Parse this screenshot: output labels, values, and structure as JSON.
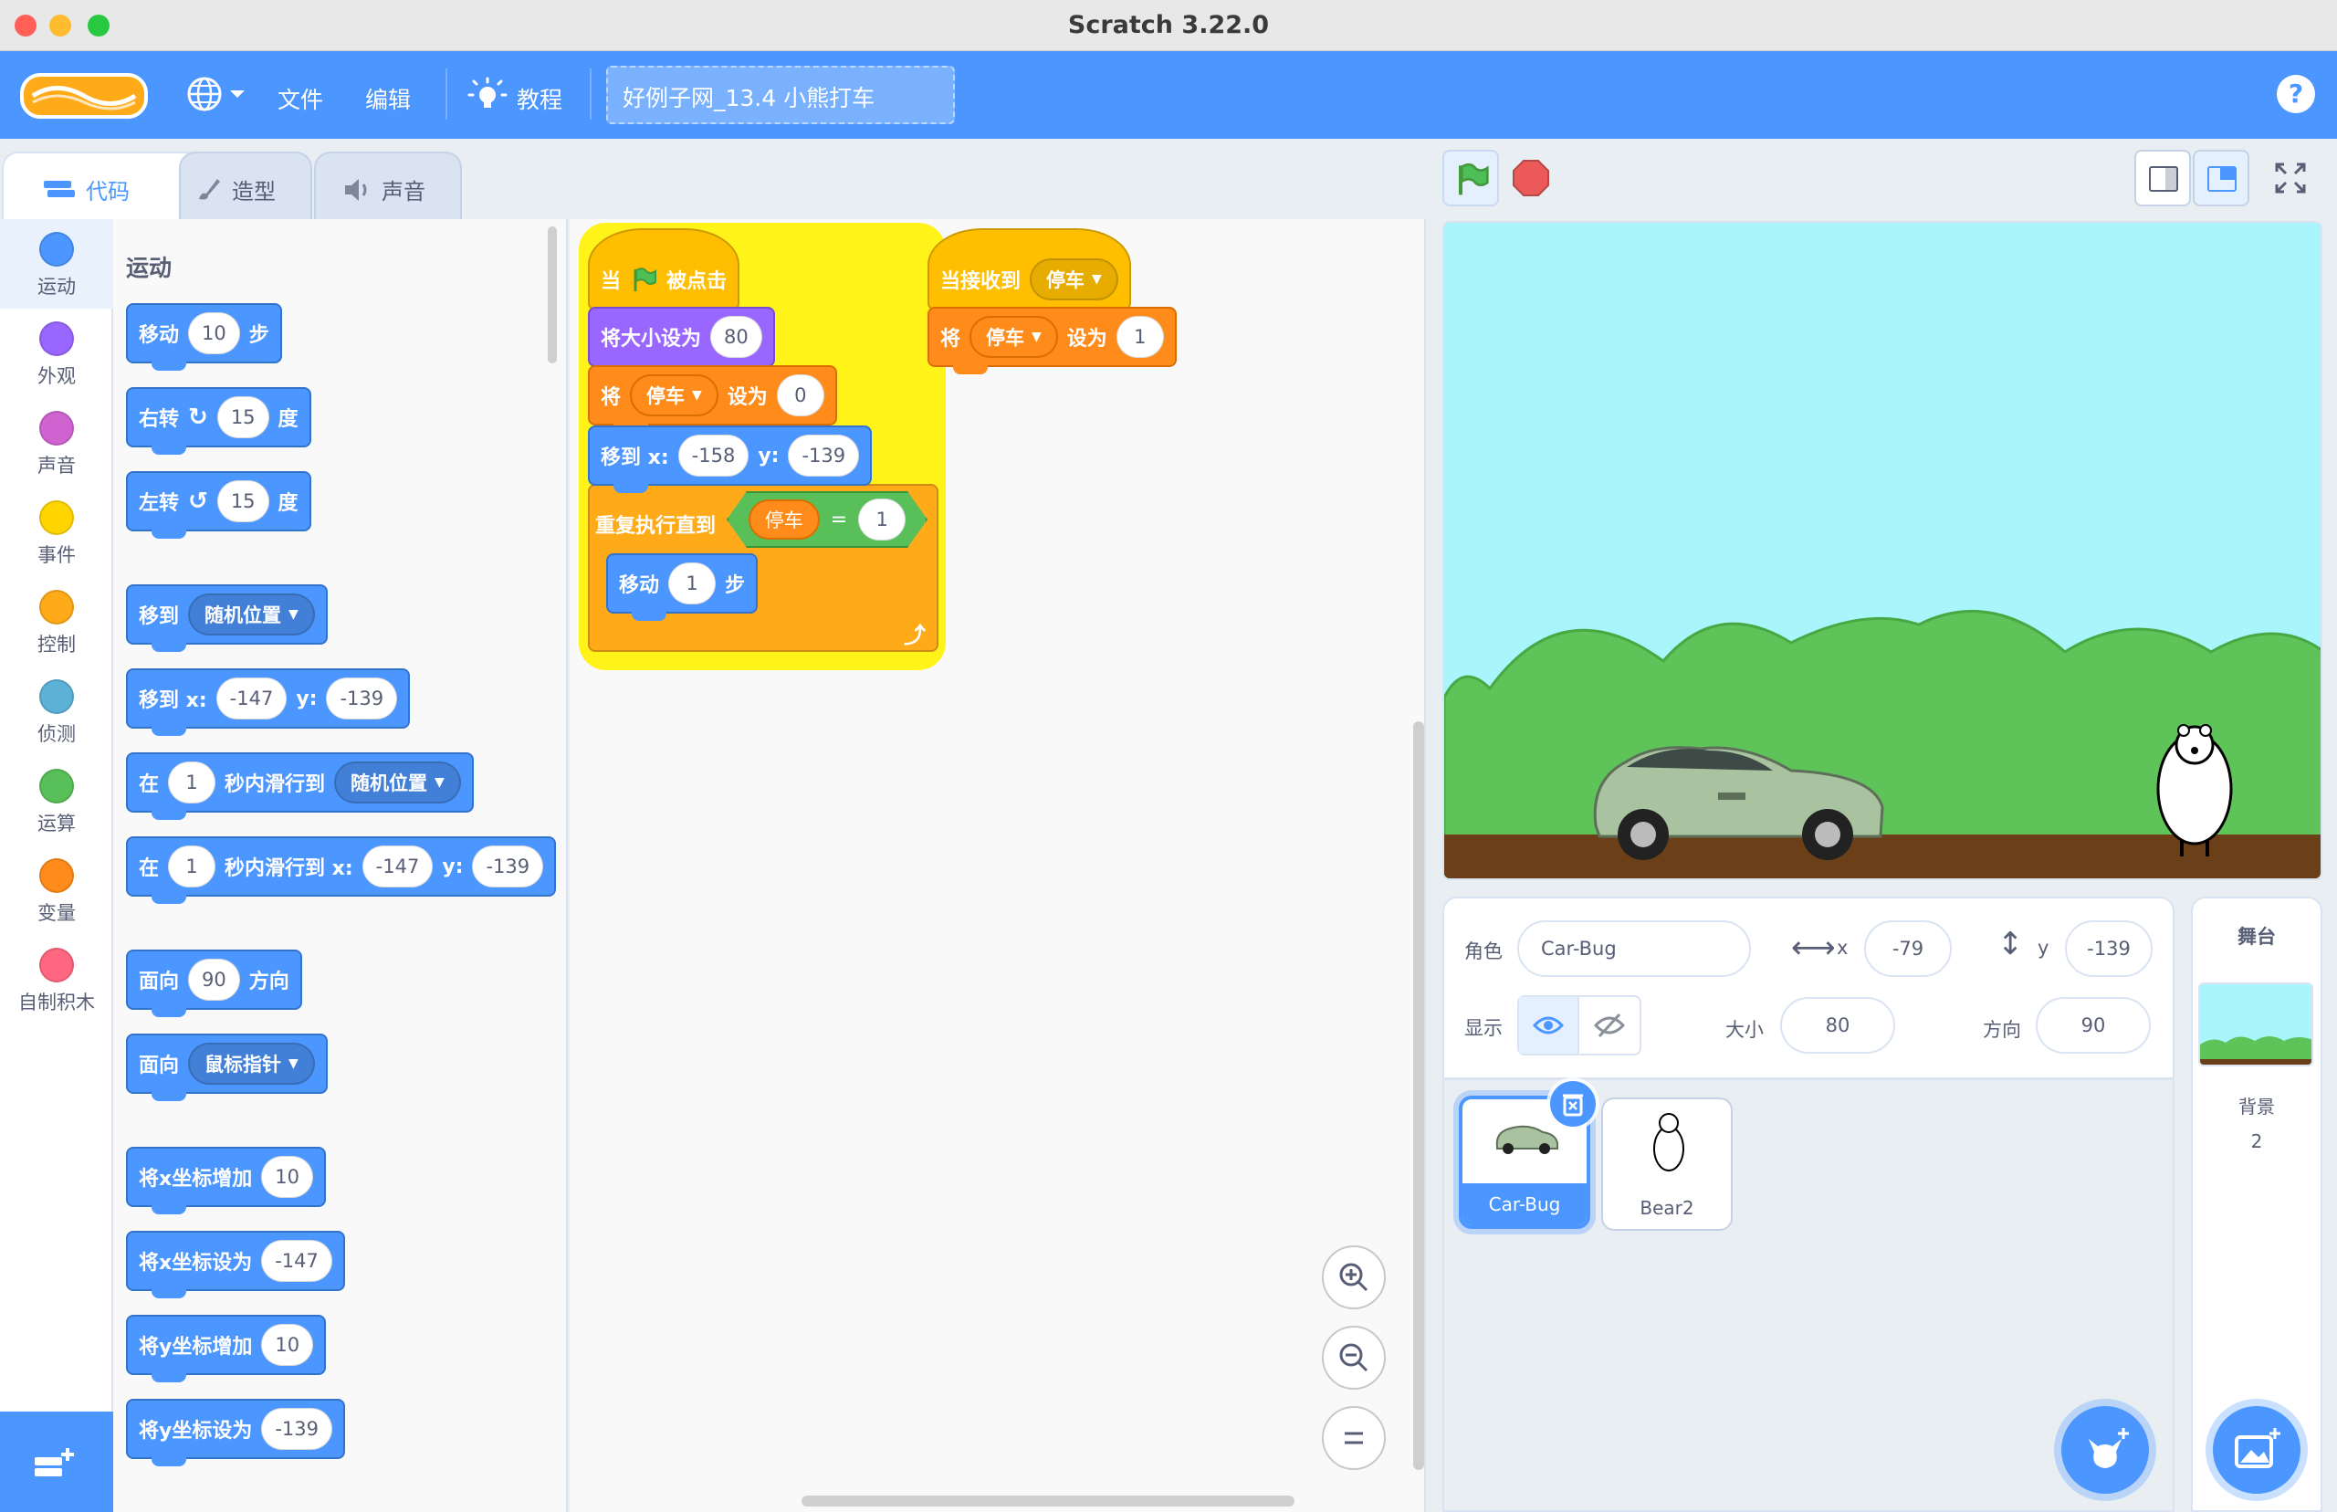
{
  "window": {
    "title": "Scratch 3.22.0"
  },
  "menu": {
    "file": "文件",
    "edit": "编辑",
    "tutorials": "教程",
    "project_title": "好例子网_13.4 小熊打车",
    "help": "?"
  },
  "tabs": {
    "code": "代码",
    "costumes": "造型",
    "sounds": "声音"
  },
  "categories": [
    {
      "label": "运动",
      "color": "#4c97ff"
    },
    {
      "label": "外观",
      "color": "#9966ff"
    },
    {
      "label": "声音",
      "color": "#cf63cf"
    },
    {
      "label": "事件",
      "color": "#ffd500"
    },
    {
      "label": "控制",
      "color": "#ffab19"
    },
    {
      "label": "侦测",
      "color": "#5cb1d6"
    },
    {
      "label": "运算",
      "color": "#59c059"
    },
    {
      "label": "变量",
      "color": "#ff8c1a"
    },
    {
      "label": "自制积木",
      "color": "#ff6680"
    }
  ],
  "palette": {
    "heading": "运动",
    "move": {
      "a": "移动",
      "n": "10",
      "b": "步"
    },
    "turn_right": {
      "a": "右转",
      "n": "15",
      "b": "度"
    },
    "turn_left": {
      "a": "左转",
      "n": "15",
      "b": "度"
    },
    "goto": {
      "a": "移到",
      "dd": "随机位置"
    },
    "goto_xy": {
      "a": "移到 x:",
      "x": "-147",
      "b": "y:",
      "y": "-139"
    },
    "glide": {
      "a": "在",
      "n": "1",
      "b": "秒内滑行到",
      "dd": "随机位置"
    },
    "glide_xy": {
      "a": "在",
      "n": "1",
      "b": "秒内滑行到 x:",
      "x": "-147",
      "c": "y:",
      "y": "-139"
    },
    "point_dir": {
      "a": "面向",
      "n": "90",
      "b": "方向"
    },
    "point_towards": {
      "a": "面向",
      "dd": "鼠标指针"
    },
    "change_x": {
      "a": "将x坐标增加",
      "n": "10"
    },
    "set_x": {
      "a": "将x坐标设为",
      "n": "-147"
    },
    "change_y": {
      "a": "将y坐标增加",
      "n": "10"
    },
    "set_y": {
      "a": "将y坐标设为",
      "n": "-139"
    }
  },
  "script1": {
    "hat": {
      "a": "当",
      "b": "被点击"
    },
    "set_size": {
      "a": "将大小设为",
      "n": "80"
    },
    "set_var": {
      "a": "将",
      "var": "停车",
      "b": "设为",
      "n": "0"
    },
    "goto_xy": {
      "a": "移到 x:",
      "x": "-158",
      "b": "y:",
      "y": "-139"
    },
    "repeat_until": {
      "a": "重复执行直到",
      "var": "停车",
      "eq": "=",
      "n": "1"
    },
    "move": {
      "a": "移动",
      "n": "1",
      "b": "步"
    }
  },
  "script2": {
    "hat": {
      "a": "当接收到",
      "msg": "停车"
    },
    "set_var": {
      "a": "将",
      "var": "停车",
      "b": "设为",
      "n": "1"
    }
  },
  "sprite_info": {
    "sprite_label": "角色",
    "sprite_name": "Car-Bug",
    "x_label": "x",
    "x": "-79",
    "y_label": "y",
    "y": "-139",
    "show_label": "显示",
    "size_label": "大小",
    "size": "80",
    "dir_label": "方向",
    "direction": "90"
  },
  "sprites": [
    {
      "name": "Car-Bug"
    },
    {
      "name": "Bear2"
    }
  ],
  "stage_panel": {
    "title": "舞台",
    "backdrops_label": "背景",
    "backdrops_count": "2"
  }
}
